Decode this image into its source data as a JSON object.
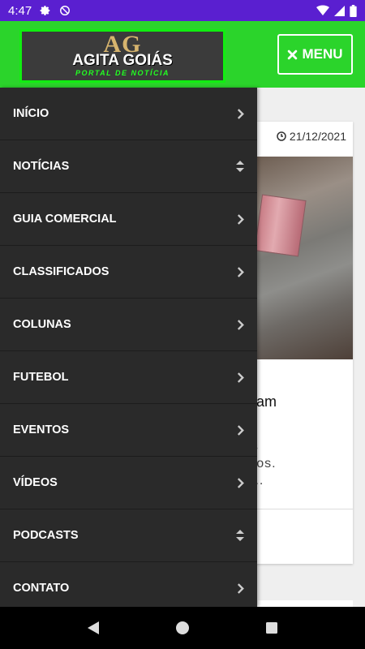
{
  "status_bar": {
    "time": "4:47",
    "icons": [
      "gear-icon",
      "no-disturb-icon",
      "wifi-icon",
      "signal-icon",
      "battery-icon"
    ]
  },
  "header": {
    "logo": {
      "ag": "AG",
      "title": "AGITA GOIÁS",
      "subtitle": "PORTAL DE NOTÍCIA"
    },
    "menu_button": {
      "icon": "close-icon",
      "label": "MENU"
    },
    "colors": {
      "header": "#2bd42b",
      "logo_border": "#11ee11",
      "status_bar": "#5a1fd0"
    }
  },
  "drawer": {
    "items": [
      {
        "label": "INÍCIO",
        "icon": "chevron-right-icon"
      },
      {
        "label": "NOTÍCIAS",
        "icon": "sort-icon"
      },
      {
        "label": "GUIA COMERCIAL",
        "icon": "chevron-right-icon"
      },
      {
        "label": "CLASSIFICADOS",
        "icon": "chevron-right-icon"
      },
      {
        "label": "COLUNAS",
        "icon": "chevron-right-icon"
      },
      {
        "label": "FUTEBOL",
        "icon": "chevron-right-icon"
      },
      {
        "label": "EVENTOS",
        "icon": "chevron-right-icon"
      },
      {
        "label": "VÍDEOS",
        "icon": "chevron-right-icon"
      },
      {
        "label": "PODCASTS",
        "icon": "sort-icon"
      },
      {
        "label": "CONTATO",
        "icon": "chevron-right-icon"
      }
    ]
  },
  "article": {
    "date": "21/12/2021",
    "title_fragment": "eram",
    "excerpt_lines": [
      "os",
      "uros.",
      "s..."
    ]
  },
  "navbar": {
    "icons": [
      "back-icon",
      "home-icon",
      "recents-icon"
    ]
  }
}
